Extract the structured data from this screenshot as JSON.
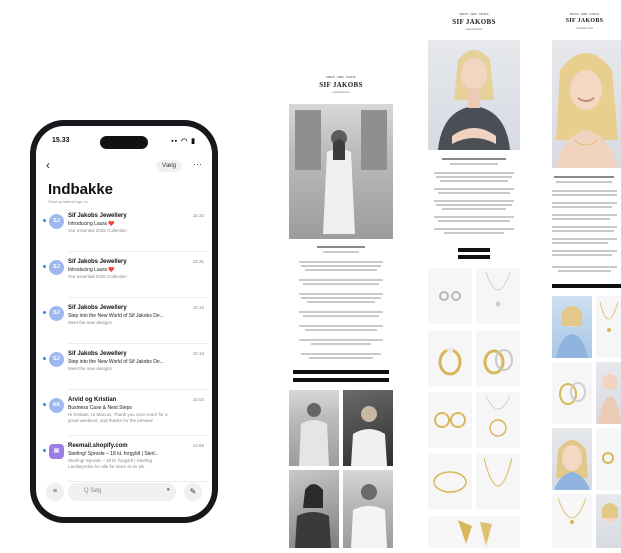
{
  "phone": {
    "status_time": "15.33",
    "status_icons": "▪▪ ◠ ▮",
    "edit_label": "Vælg",
    "more_label": "···",
    "back_glyph": "‹",
    "inbox_title": "Indbakke",
    "inbox_subtitle": "Sidst opdateret lige nu",
    "search_placeholder": "Q  Søg",
    "emails": [
      {
        "avatar": "SJ",
        "sender": "Sif Jakobs Jewellery",
        "time": "15.32",
        "subject": "Introducing Laura ❤️",
        "preview": "Our essential 2025 Collection",
        "preview2": "",
        "shape": "round"
      },
      {
        "avatar": "SJ",
        "sender": "Sif Jakobs Jewellery",
        "time": "15.31",
        "subject": "Introducing Laura ❤️",
        "preview": "Our essential 2025 Collection",
        "preview2": "",
        "shape": "round"
      },
      {
        "avatar": "SJ",
        "sender": "Sif Jakobs Jewellery",
        "time": "15.12",
        "subject": "Step into the New World of Sif Jakobs De...",
        "preview": "Meet the new designs",
        "preview2": "",
        "shape": "round"
      },
      {
        "avatar": "SJ",
        "sender": "Sif Jakobs Jewellery",
        "time": "15.10",
        "subject": "Step into the New World of Sif Jakobs De...",
        "preview": "Meet the new designs",
        "preview2": "",
        "shape": "round"
      },
      {
        "avatar": "AK",
        "sender": "Arvid og Kristian",
        "time": "15.03",
        "subject": "Business Case & Next Steps",
        "preview": "Hi Kristian, Hi Marcus, Thank you once more for a",
        "preview2": "great weekend, and thanks for the preview",
        "shape": "round"
      },
      {
        "avatar": "▤",
        "sender": "Reemail.shopify.com",
        "time": "14.58",
        "subject": "Sterling! Sprosle – 18 kt. forgyldt | Sterl...",
        "preview": "Sterling! Sprosle – 18 kt. forgyldt | Sterling",
        "preview2": "Landstyrelse for alle for store at en tek",
        "shape": "square"
      }
    ]
  },
  "email_brand": {
    "tagline": "SINCE · 2009 · STOCK",
    "name": "SIF JAKOBS",
    "location": "COPENHAGEN"
  },
  "colors": {
    "phone_frame": "#17181b",
    "unread_dot": "#3b82f6",
    "avatar_blue": "#9db8ef",
    "avatar_purple": "#9b7ee8",
    "cta": "#111111"
  }
}
